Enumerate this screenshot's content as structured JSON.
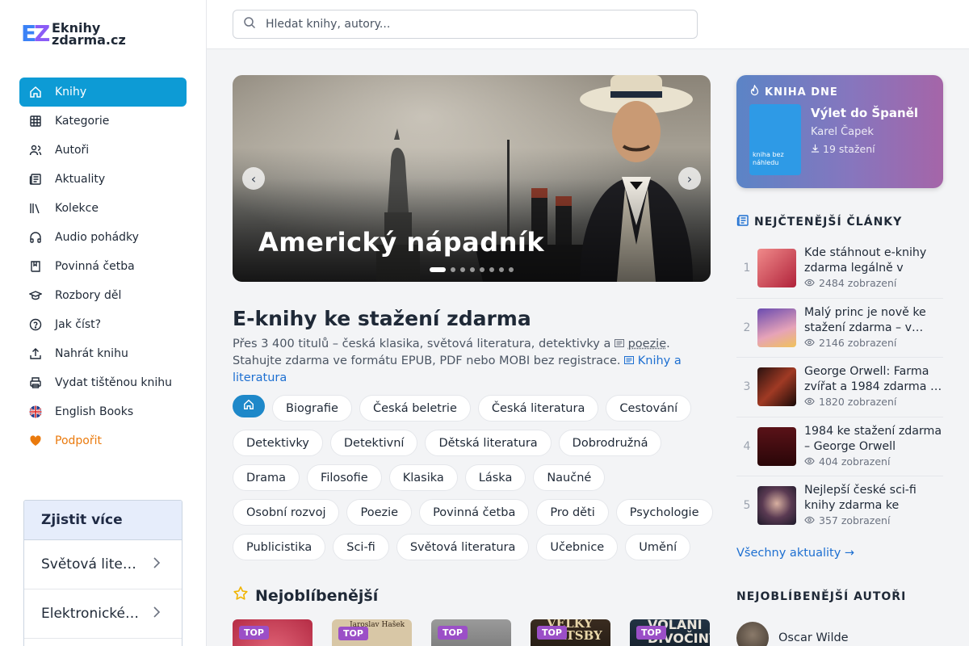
{
  "logo": {
    "mark_e": "E",
    "mark_z": "Z",
    "line1": "Eknihy",
    "line2": "zdarma.cz"
  },
  "search": {
    "placeholder": "Hledat knihy, autory..."
  },
  "nav": [
    {
      "label": "Knihy",
      "icon": "home-icon"
    },
    {
      "label": "Kategorie",
      "icon": "grid-icon"
    },
    {
      "label": "Autoři",
      "icon": "users-icon"
    },
    {
      "label": "Aktuality",
      "icon": "newspaper-icon"
    },
    {
      "label": "Kolekce",
      "icon": "library-icon"
    },
    {
      "label": "Audio pohádky",
      "icon": "headphones-icon"
    },
    {
      "label": "Povinná četba",
      "icon": "bookmark-book-icon"
    },
    {
      "label": "Rozbory děl",
      "icon": "graduation-cap-icon"
    },
    {
      "label": "Jak číst?",
      "icon": "help-circle-icon"
    },
    {
      "label": "Nahrát knihu",
      "icon": "upload-icon"
    },
    {
      "label": "Vydat tištěnou knihu",
      "icon": "printer-icon"
    },
    {
      "label": "English Books",
      "icon": "uk-flag-icon"
    },
    {
      "label": "Podpořit",
      "icon": "heart-icon"
    }
  ],
  "more": {
    "title": "Zjistit více",
    "items": [
      "Světová literatura",
      "Elektronické knihy"
    ]
  },
  "hero": {
    "title": "Americký nápadník",
    "prev": "‹",
    "next": "›",
    "slides": 8,
    "active": 1
  },
  "intro": {
    "heading": "E-knihy ke stažení zdarma",
    "text1": "Přes 3 400 titulů – česká klasika, světová literatura, detektivky a ",
    "keyword": "poezie",
    "text2": ". Stahujte zdarma ve formátu EPUB, PDF nebo MOBI bez registrace. ",
    "link": "Knihy a literatura"
  },
  "genres": [
    "Biografie",
    "Česká beletrie",
    "Česká literatura",
    "Cestování",
    "Detektivky",
    "Detektivní",
    "Dětská literatura",
    "Dobrodružná",
    "Drama",
    "Filosofie",
    "Klasika",
    "Láska",
    "Naučné",
    "Osobní rozvoj",
    "Poezie",
    "Povinná četba",
    "Pro děti",
    "Psychologie",
    "Publicistika",
    "Sci-fi",
    "Světová literatura",
    "Učebnice",
    "Umění"
  ],
  "favorites": {
    "title": "Nejoblíbenější",
    "tag": "TOP",
    "covers": [
      {
        "color": "#c9344e",
        "text": ""
      },
      {
        "color": "#d8c7a6",
        "text": "Jaroslav Hašek"
      },
      {
        "color": "#8a8a8a",
        "text": ""
      },
      {
        "color": "#2a2018",
        "text": "VELKÝ GATSBY"
      },
      {
        "color": "#1a2530",
        "text": "VOLÁNÍ DIVOČINY"
      }
    ]
  },
  "book_of_day": {
    "label": "KNIHA DNE",
    "title": "Výlet do Španěl",
    "author": "Karel Čapek",
    "downloads": "19 stažení",
    "cover_text": "kniha bez náhledu"
  },
  "articles_head": "NEJČTENĚJŠÍ ČLÁNKY",
  "articles": [
    {
      "num": "1",
      "title": "Kde stáhnout e-knihy zdarma legálně v roce…",
      "views": "2484 zobrazení",
      "color": "#c44a5a"
    },
    {
      "num": "2",
      "title": "Malý princ je nově ke stažení zdarma – v…",
      "views": "2146 zobrazení",
      "color": "#b58bd6"
    },
    {
      "num": "3",
      "title": "George Orwell: Farma zvířat a 1984 zdarma …",
      "views": "1820 zobrazení",
      "color": "#5a2a24"
    },
    {
      "num": "4",
      "title": "1984 ke stažení zdarma – George Orwell",
      "views": "404 zobrazení",
      "color": "#3a0d10"
    },
    {
      "num": "5",
      "title": "Nejlepší české sci-fi knihy zdarma ke stažení",
      "views": "357 zobrazení",
      "color": "#4a3c55"
    }
  ],
  "all_news": "Všechny aktuality →",
  "authors_head": "NEJOBLÍBENĚJŠÍ AUTOŘI",
  "top_author": "Oscar Wilde",
  "colors": {
    "accent": "#0d9bd5",
    "link": "#1d6fd1",
    "support": "#ea7a0d",
    "tag": "#9b4fc7"
  }
}
